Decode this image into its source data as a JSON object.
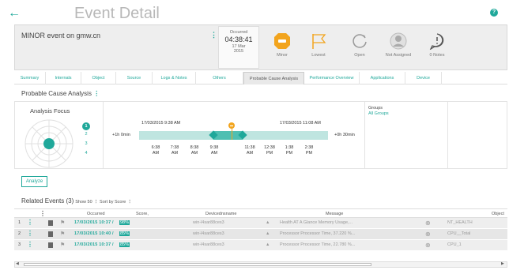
{
  "page": {
    "title": "Event Detail",
    "back_icon": "arrow-left-icon",
    "help_icon": "help-icon"
  },
  "event": {
    "name": "MINOR event on gmw.cn",
    "occurred_label": "Occurred",
    "occurred_time": "04:38:41",
    "occurred_date": "17 Mar",
    "occurred_year": "2015"
  },
  "status": [
    {
      "label": "Minor",
      "icon": "severity-icon",
      "color": "#f2a41d"
    },
    {
      "label": "Lowest",
      "icon": "flag-icon",
      "color": "#f2a41d"
    },
    {
      "label": "Open",
      "icon": "open-status-icon",
      "color": "#999999"
    },
    {
      "label": "Not Assigned",
      "icon": "user-icon",
      "color": "#999999"
    },
    {
      "label": "0 Notes",
      "icon": "notes-icon",
      "color": "#555555"
    }
  ],
  "tabs": [
    {
      "label": "Summary"
    },
    {
      "label": "Internals"
    },
    {
      "label": "Object"
    },
    {
      "label": "Source"
    },
    {
      "label": "Logs & Notes"
    },
    {
      "label": "Others"
    },
    {
      "label": "Probable Cause Analysis",
      "active": true
    },
    {
      "label": "Performance Overview"
    },
    {
      "label": "Applications"
    },
    {
      "label": "Device"
    }
  ],
  "analysis": {
    "title": "Probable Cause Analysis",
    "focus_title": "Analysis Focus",
    "levels": [
      "1",
      "2",
      "3",
      "4"
    ],
    "groups_label": "Groups",
    "groups_link": "All Groups",
    "timeline": {
      "start_label": "17/03/2015 9:38 AM",
      "end_label": "17/03/2015 11:08 AM",
      "minus_label": "+1h 0min",
      "plus_label": "+0h 30min",
      "ticks": [
        {
          "time": "6:38",
          "ampm": "AM"
        },
        {
          "time": "7:38",
          "ampm": "AM"
        },
        {
          "time": "8:38",
          "ampm": "AM"
        },
        {
          "time": "9:38",
          "ampm": "AM"
        },
        {
          "time": "11:38",
          "ampm": "AM"
        },
        {
          "time": "12:38",
          "ampm": "PM"
        },
        {
          "time": "1:38",
          "ampm": "PM"
        },
        {
          "time": "2:38",
          "ampm": "PM"
        }
      ]
    },
    "analyze_button": "Analyze"
  },
  "related": {
    "title": "Related Events (3)",
    "show": "Show 50",
    "sort": "Sort by Score",
    "columns": {
      "occurred": "Occurred",
      "score": "Score,",
      "device": "Devicednsname",
      "message": "Message",
      "object": "Object"
    },
    "rows": [
      {
        "num": "1",
        "occurred": "17/03/2015 10:37 /",
        "score": "98%",
        "device": "win-l4sar88ces3",
        "message": "Health AT A Glance Memory Usage,...",
        "object": "NT_HEALTH"
      },
      {
        "num": "2",
        "occurred": "17/03/2015 10:40 /",
        "score": "85%",
        "device": "win-l4sar88ces3",
        "message": "Processor Processor Time, 37.220 %...",
        "object": "CPU__Total"
      },
      {
        "num": "3",
        "occurred": "17/03/2015 10:37 /",
        "score": "85%",
        "device": "win-l4sar88ces3",
        "message": "Processor Processor Time, 22.780 %...",
        "object": "CPU_1"
      }
    ]
  },
  "colors": {
    "accent": "#1fa89a",
    "warning": "#f2a41d"
  }
}
